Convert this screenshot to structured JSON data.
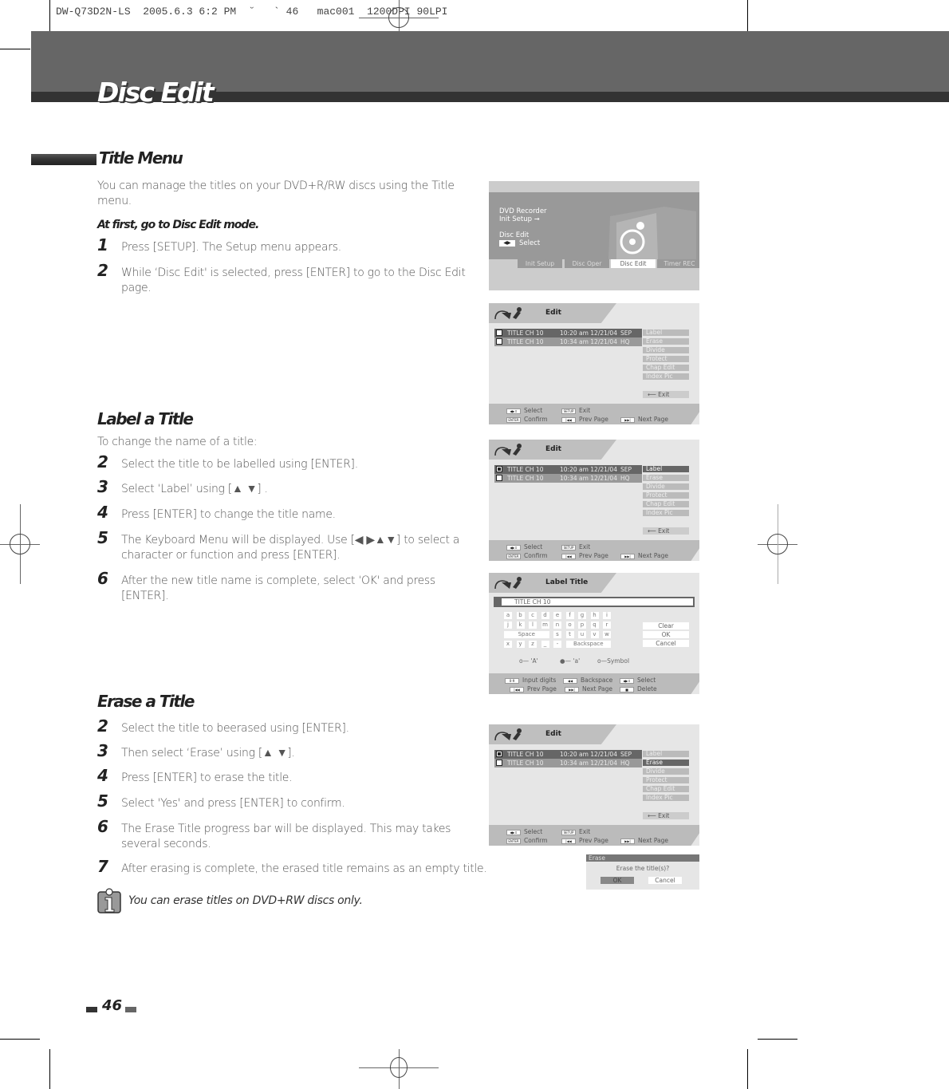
{
  "slug": "DW-Q73D2N-LS  2005.6.3 6:2 PM  ˘   ` 46   mac001  1200DPI 90LPI",
  "chapter_title": "Disc Edit",
  "page_number": "46",
  "sections": {
    "title_menu": {
      "heading": "Title Menu",
      "intro": "You can manage the titles on your DVD+R/RW  discs using the Title menu.",
      "subheading": "At first, go to Disc Edit mode.",
      "steps": [
        {
          "num": "1",
          "text": "Press [SETUP]. The Setup menu appears."
        },
        {
          "num": "2",
          "text": "While ‘Disc Edit' is selected, press [ENTER] to go to the Disc Edit page."
        }
      ]
    },
    "label_title": {
      "heading": "Label a Title",
      "intro": "To change the name of a title:",
      "steps": [
        {
          "num": "2",
          "text": "Select the title to be labelled using [ENTER]."
        },
        {
          "num": "3",
          "text": "Select ‘Label’ using [▲ ▼] ."
        },
        {
          "num": "4",
          "text": "Press [ENTER] to change the title name."
        },
        {
          "num": "5",
          "text": "The Keyboard Menu will be displayed. Use [◀ ▶▲▼] to select a character or function and press [ENTER]."
        },
        {
          "num": "6",
          "text": " After the new title name is complete, select ‘OK' and press [ENTER]."
        }
      ]
    },
    "erase_title": {
      "heading": "Erase a Title",
      "steps": [
        {
          "num": "2",
          "text": "Select the title to beerased using [ENTER]."
        },
        {
          "num": "3",
          "text": "Then select ‘Erase’ using [▲ ▼]."
        },
        {
          "num": "4",
          "text": "Press [ENTER] to erase the title."
        },
        {
          "num": "5",
          "text": "Select 'Yes'  and press [ENTER] to confirm."
        },
        {
          "num": "6",
          "text": "The Erase Title progress bar will be displayed. This may takes several seconds."
        },
        {
          "num": "7",
          "text": "After erasing is complete, the erased title remains as an empty title."
        }
      ],
      "note": "You can erase titles on DVD+RW  discs only."
    }
  },
  "setup_screen": {
    "line1": "DVD Recorder",
    "line2": "Init Setup  ➞",
    "line3": "Disc Edit",
    "select_label": "Select",
    "tabs": [
      "Init Setup",
      "Disc Oper",
      "Disc Edit",
      "Timer REC"
    ],
    "active_tab": "Disc Edit"
  },
  "edit_screen": {
    "title": "Edit",
    "rows": [
      {
        "name": "TITLE CH 10",
        "time": "10:20 am 12/21/04",
        "quality": "SEP"
      },
      {
        "name": "TITLE CH 10",
        "time": "10:34 am 12/21/04",
        "quality": "HQ"
      }
    ],
    "menu": [
      "Label",
      "Erase",
      "Divide",
      "Protect",
      "Chap Edit",
      "Index Pic"
    ],
    "exit": "Exit",
    "footer": {
      "select": "Select",
      "exit": "Exit",
      "confirm": "Confirm",
      "prev_page": "Prev Page",
      "next_page": "Next Page",
      "setup_key": "SETUP",
      "enter_key": "ENTER"
    }
  },
  "label_screen": {
    "title": "Label Title",
    "input_value": "TITLE CH 10",
    "keys_row1": [
      "a",
      "b",
      "c",
      "d",
      "e",
      "f",
      "g",
      "h",
      "i"
    ],
    "keys_row2": [
      "j",
      "k",
      "l",
      "m",
      "n",
      "o",
      "p",
      "q",
      "r"
    ],
    "keys_row3_space": "Space",
    "keys_row3": [
      "s",
      "t",
      "u",
      "v",
      "w"
    ],
    "keys_row4": [
      "x",
      "y",
      "z",
      "_",
      "-"
    ],
    "backspace": "Backspace",
    "buttons": [
      "Clear",
      "OK",
      "Cancel"
    ],
    "modes": [
      "'A'",
      "'a'",
      "Symbol"
    ],
    "footer": {
      "input_digits": "Input digits",
      "digits_key": "0-9",
      "backspace": "Backspace",
      "select": "Select",
      "prev_page": "Prev Page",
      "next_page": "Next Page",
      "delete": "Delete"
    }
  },
  "erase_dialog": {
    "title": "Erase",
    "message": "Erase the title(s)?",
    "ok": "OK",
    "cancel": "Cancel"
  }
}
